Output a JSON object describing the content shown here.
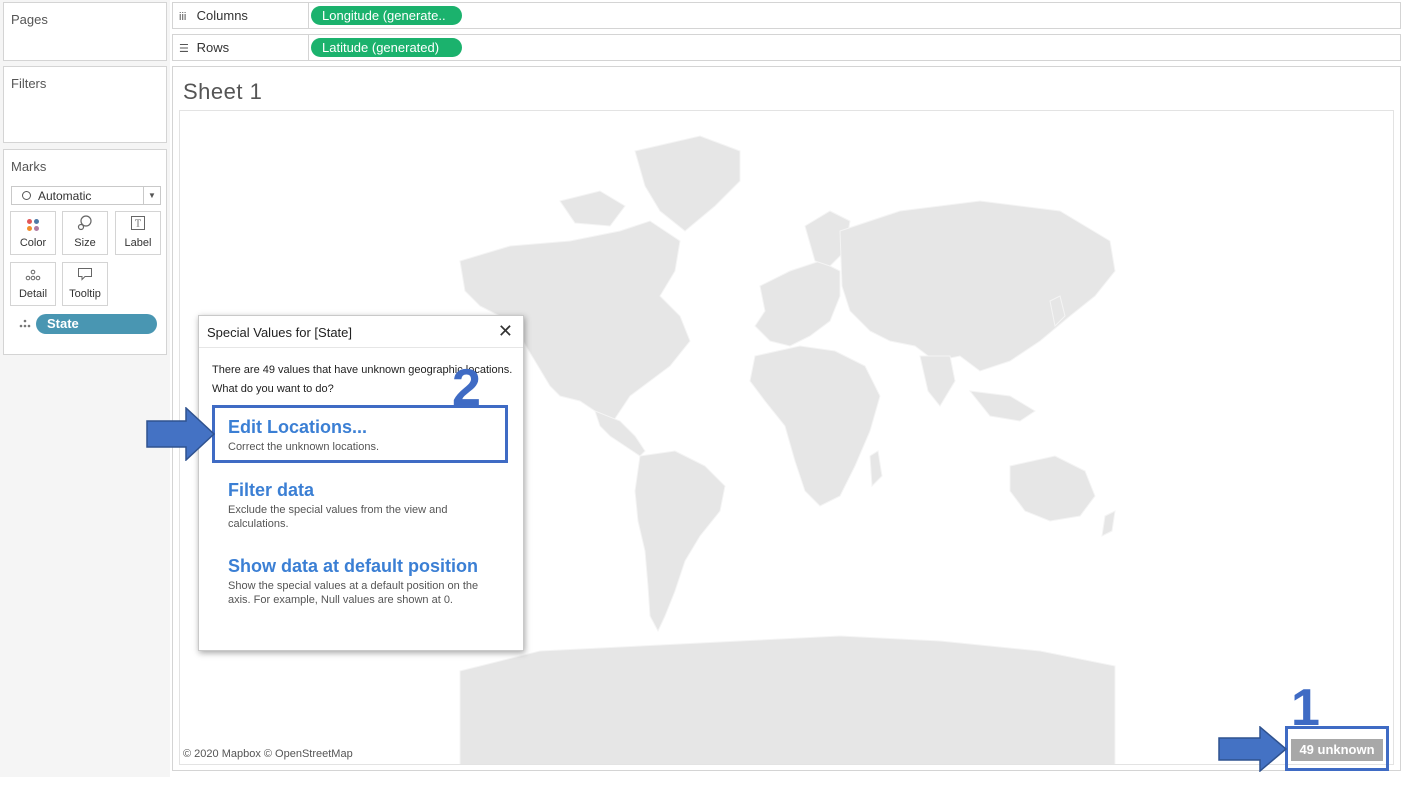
{
  "left_pane": {
    "pages_title": "Pages",
    "filters_title": "Filters",
    "marks_title": "Marks",
    "mark_type": "Automatic",
    "mark_buttons": {
      "color": "Color",
      "size": "Size",
      "label": "Label",
      "detail": "Detail",
      "tooltip": "Tooltip"
    },
    "state_pill": "State"
  },
  "shelves": {
    "columns_label": "Columns",
    "columns_pill": "Longitude (generate..",
    "rows_label": "Rows",
    "rows_pill": "Latitude (generated)"
  },
  "sheet": {
    "title": "Sheet 1",
    "credit": "© 2020 Mapbox © OpenStreetMap",
    "unknown_badge": "49 unknown"
  },
  "dialog": {
    "title": "Special Values for [State]",
    "message_line1": "There are 49 values that have unknown geographic locations.",
    "message_line2": "What do you want to do?",
    "options": [
      {
        "heading": "Edit Locations...",
        "description": "Correct the unknown locations."
      },
      {
        "heading": "Filter data",
        "description": "Exclude the special values from the view and calculations."
      },
      {
        "heading": "Show data at default position",
        "description": "Show the special values at a default position on the axis. For example, Null values are shown at 0."
      }
    ]
  },
  "annotations": {
    "step1": "1",
    "step2": "2"
  },
  "colors": {
    "pill_green": "#1bb26d",
    "pill_blue": "#4996b2",
    "link_blue": "#3b7fd4",
    "annotation_blue": "#3f6bc4",
    "map_land": "#e6e6e6"
  }
}
